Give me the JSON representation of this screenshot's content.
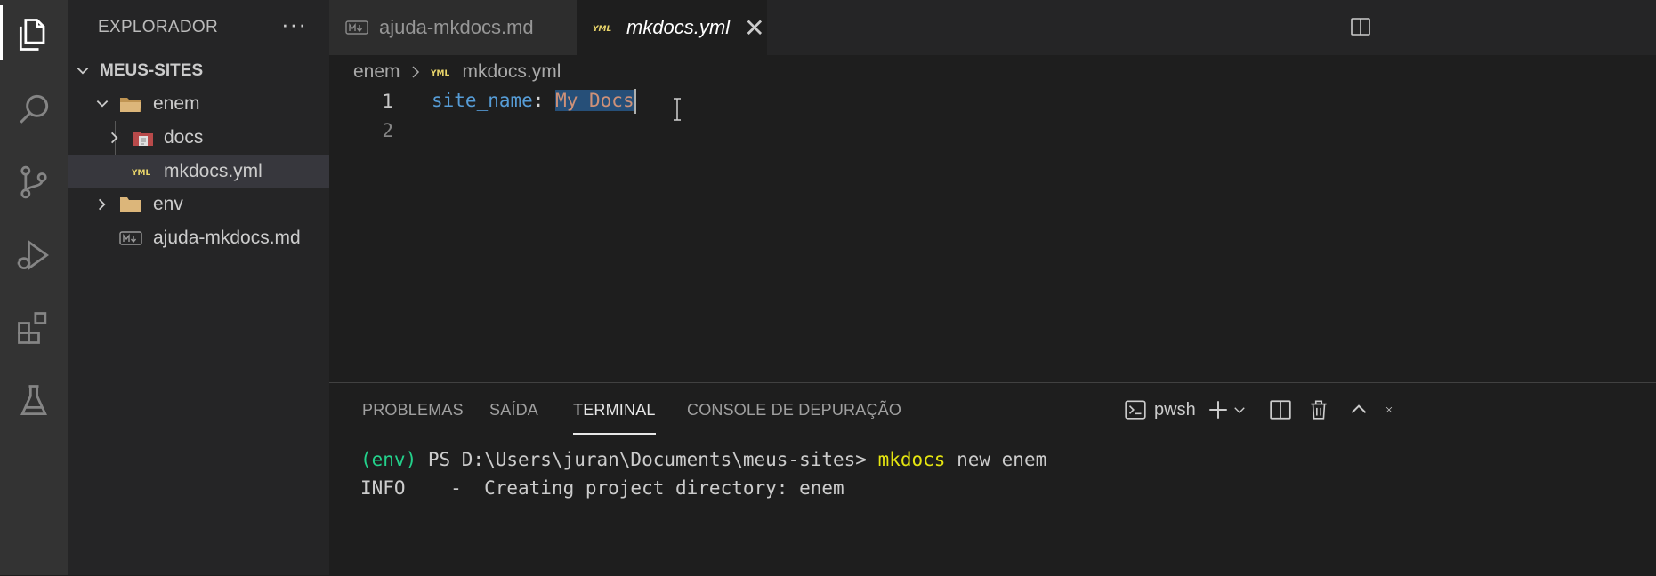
{
  "sidebar": {
    "title": "EXPLORADOR",
    "more": "···",
    "root": "MEUS-SITES",
    "items": [
      {
        "label": "enem"
      },
      {
        "label": "docs"
      },
      {
        "label": "mkdocs.yml"
      },
      {
        "label": "env"
      },
      {
        "label": "ajuda-mkdocs.md"
      }
    ]
  },
  "tabs": [
    {
      "label": "ajuda-mkdocs.md",
      "icon": "markdown-file-icon"
    },
    {
      "label": "mkdocs.yml",
      "icon": "yaml-file-icon",
      "close": "✕"
    }
  ],
  "breadcrumb": {
    "folder": "enem",
    "file": "mkdocs.yml"
  },
  "editor": {
    "lines": [
      {
        "number": "1",
        "key": "site_name",
        "colon": ": ",
        "value": "My Docs"
      },
      {
        "number": "2"
      }
    ]
  },
  "panel": {
    "tabs": [
      "PROBLEMAS",
      "SAÍDA",
      "TERMINAL",
      "CONSOLE DE DEPURAÇÃO"
    ],
    "active_tab": "TERMINAL",
    "shell": "pwsh",
    "terminal": {
      "env": "(env)",
      "prompt": " PS D:\\Users\\juran\\Documents\\meus-sites> ",
      "command": "mkdocs",
      "args": " new enem",
      "line2": "INFO    -  Creating project directory: enem"
    }
  },
  "colors": {
    "activity_bg": "#333333",
    "sidebar_bg": "#252526",
    "editor_bg": "#1e1e1e",
    "yaml_key": "#569cd6",
    "yaml_value": "#ce9178",
    "selection": "#264f78",
    "terminal_env": "#23d18b",
    "terminal_command": "#e5e510"
  }
}
